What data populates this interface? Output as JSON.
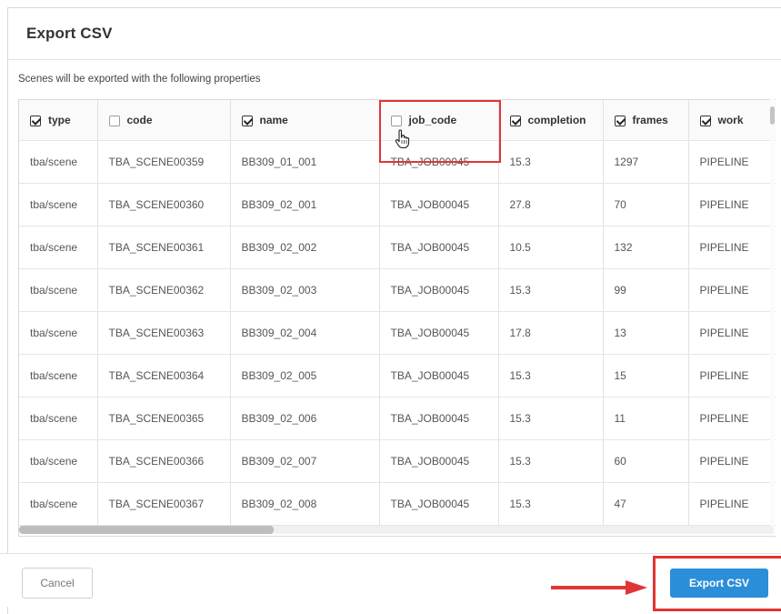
{
  "dialog": {
    "title": "Export CSV",
    "subtitle": "Scenes will be exported with the following properties"
  },
  "columns": [
    {
      "label": "type",
      "checked": true
    },
    {
      "label": "code",
      "checked": false
    },
    {
      "label": "name",
      "checked": true
    },
    {
      "label": "job_code",
      "checked": false
    },
    {
      "label": "completion",
      "checked": true
    },
    {
      "label": "frames",
      "checked": true
    },
    {
      "label": "work",
      "checked": true
    }
  ],
  "rows": [
    [
      "tba/scene",
      "TBA_SCENE00359",
      "BB309_01_001",
      "TBA_JOB00045",
      "15.3",
      "1297",
      "PIPELINE"
    ],
    [
      "tba/scene",
      "TBA_SCENE00360",
      "BB309_02_001",
      "TBA_JOB00045",
      "27.8",
      "70",
      "PIPELINE"
    ],
    [
      "tba/scene",
      "TBA_SCENE00361",
      "BB309_02_002",
      "TBA_JOB00045",
      "10.5",
      "132",
      "PIPELINE"
    ],
    [
      "tba/scene",
      "TBA_SCENE00362",
      "BB309_02_003",
      "TBA_JOB00045",
      "15.3",
      "99",
      "PIPELINE"
    ],
    [
      "tba/scene",
      "TBA_SCENE00363",
      "BB309_02_004",
      "TBA_JOB00045",
      "17.8",
      "13",
      "PIPELINE"
    ],
    [
      "tba/scene",
      "TBA_SCENE00364",
      "BB309_02_005",
      "TBA_JOB00045",
      "15.3",
      "15",
      "PIPELINE"
    ],
    [
      "tba/scene",
      "TBA_SCENE00365",
      "BB309_02_006",
      "TBA_JOB00045",
      "15.3",
      "11",
      "PIPELINE"
    ],
    [
      "tba/scene",
      "TBA_SCENE00366",
      "BB309_02_007",
      "TBA_JOB00045",
      "15.3",
      "60",
      "PIPELINE"
    ],
    [
      "tba/scene",
      "TBA_SCENE00367",
      "BB309_02_008",
      "TBA_JOB00045",
      "15.3",
      "47",
      "PIPELINE"
    ]
  ],
  "footer": {
    "cancel_label": "Cancel",
    "export_label": "Export CSV"
  },
  "colors": {
    "accent": "#2b8ed9",
    "highlight": "#e03535"
  },
  "icons": {
    "cursor": "hand-pointer-icon",
    "arrow": "arrow-right-icon"
  }
}
